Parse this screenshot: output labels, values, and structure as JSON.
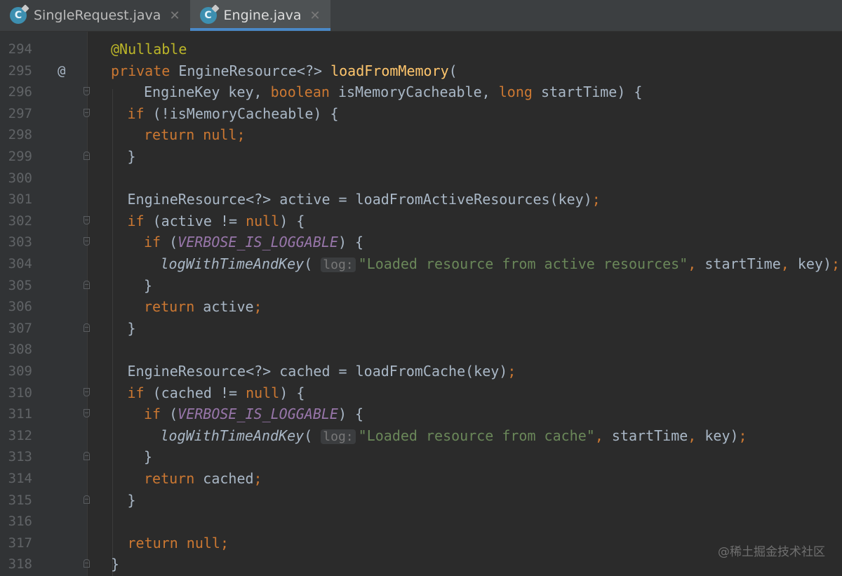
{
  "tabs": [
    {
      "label": "SingleRequest.java",
      "icon": "java-class-icon",
      "close": "✕",
      "active": false
    },
    {
      "label": "Engine.java",
      "icon": "java-class-icon",
      "close": "✕",
      "active": true
    }
  ],
  "colors": {
    "keyword": "#cc7832",
    "annotation": "#bbb529",
    "method": "#ffc66d",
    "string": "#6a8759",
    "constant": "#9876aa",
    "text": "#a9b7c6",
    "accent": "#4a88c7"
  },
  "editor": {
    "lines": [
      {
        "num": "294",
        "indent": 0,
        "gutter_mark": "",
        "fold": "",
        "tokens": [
          [
            "a",
            "@Nullable"
          ]
        ]
      },
      {
        "num": "295",
        "indent": 0,
        "gutter_mark": "@",
        "fold": "",
        "tokens": [
          [
            "k",
            "private "
          ],
          [
            "t",
            "EngineResource<?> "
          ],
          [
            "f",
            "loadFromMemory"
          ],
          [
            "t",
            "("
          ]
        ]
      },
      {
        "num": "296",
        "indent": 2,
        "gutter_mark": "",
        "fold": "open",
        "tokens": [
          [
            "t",
            "EngineKey key, "
          ],
          [
            "k",
            "boolean "
          ],
          [
            "t",
            "isMemoryCacheable, "
          ],
          [
            "k",
            "long "
          ],
          [
            "t",
            "startTime) {"
          ]
        ]
      },
      {
        "num": "297",
        "indent": 1,
        "gutter_mark": "",
        "fold": "open",
        "tokens": [
          [
            "k",
            "if "
          ],
          [
            "t",
            "(!isMemoryCacheable) {"
          ]
        ]
      },
      {
        "num": "298",
        "indent": 2,
        "gutter_mark": "",
        "fold": "",
        "tokens": [
          [
            "k",
            "return null;"
          ]
        ]
      },
      {
        "num": "299",
        "indent": 1,
        "gutter_mark": "",
        "fold": "close",
        "tokens": [
          [
            "t",
            "}"
          ]
        ]
      },
      {
        "num": "300",
        "indent": 0,
        "gutter_mark": "",
        "fold": "",
        "tokens": []
      },
      {
        "num": "301",
        "indent": 1,
        "gutter_mark": "",
        "fold": "",
        "tokens": [
          [
            "t",
            "EngineResource<?> active = loadFromActiveResources(key)"
          ],
          [
            "k",
            ";"
          ]
        ]
      },
      {
        "num": "302",
        "indent": 1,
        "gutter_mark": "",
        "fold": "open",
        "tokens": [
          [
            "k",
            "if "
          ],
          [
            "t",
            "(active != "
          ],
          [
            "k",
            "null"
          ],
          [
            "t",
            ") {"
          ]
        ]
      },
      {
        "num": "303",
        "indent": 2,
        "gutter_mark": "",
        "fold": "open",
        "tokens": [
          [
            "k",
            "if "
          ],
          [
            "t",
            "("
          ],
          [
            "c",
            "VERBOSE_IS_LOGGABLE"
          ],
          [
            "t",
            ") {"
          ]
        ]
      },
      {
        "num": "304",
        "indent": 3,
        "gutter_mark": "",
        "fold": "",
        "tokens": [
          [
            "i",
            "logWithTimeAndKey"
          ],
          [
            "t",
            "( "
          ],
          [
            "h",
            "log:"
          ],
          [
            "s",
            "\"Loaded resource from active resources\""
          ],
          [
            "k",
            ", "
          ],
          [
            "t",
            "startTime"
          ],
          [
            "k",
            ", "
          ],
          [
            "t",
            "key)"
          ],
          [
            "k",
            ";"
          ]
        ]
      },
      {
        "num": "305",
        "indent": 2,
        "gutter_mark": "",
        "fold": "close",
        "tokens": [
          [
            "t",
            "}"
          ]
        ]
      },
      {
        "num": "306",
        "indent": 2,
        "gutter_mark": "",
        "fold": "",
        "tokens": [
          [
            "k",
            "return "
          ],
          [
            "t",
            "active"
          ],
          [
            "k",
            ";"
          ]
        ]
      },
      {
        "num": "307",
        "indent": 1,
        "gutter_mark": "",
        "fold": "close",
        "tokens": [
          [
            "t",
            "}"
          ]
        ]
      },
      {
        "num": "308",
        "indent": 0,
        "gutter_mark": "",
        "fold": "",
        "tokens": []
      },
      {
        "num": "309",
        "indent": 1,
        "gutter_mark": "",
        "fold": "",
        "tokens": [
          [
            "t",
            "EngineResource<?> cached = loadFromCache(key)"
          ],
          [
            "k",
            ";"
          ]
        ]
      },
      {
        "num": "310",
        "indent": 1,
        "gutter_mark": "",
        "fold": "open",
        "tokens": [
          [
            "k",
            "if "
          ],
          [
            "t",
            "(cached != "
          ],
          [
            "k",
            "null"
          ],
          [
            "t",
            ") {"
          ]
        ]
      },
      {
        "num": "311",
        "indent": 2,
        "gutter_mark": "",
        "fold": "open",
        "tokens": [
          [
            "k",
            "if "
          ],
          [
            "t",
            "("
          ],
          [
            "c",
            "VERBOSE_IS_LOGGABLE"
          ],
          [
            "t",
            ") {"
          ]
        ]
      },
      {
        "num": "312",
        "indent": 3,
        "gutter_mark": "",
        "fold": "",
        "tokens": [
          [
            "i",
            "logWithTimeAndKey"
          ],
          [
            "t",
            "( "
          ],
          [
            "h",
            "log:"
          ],
          [
            "s",
            "\"Loaded resource from cache\""
          ],
          [
            "k",
            ", "
          ],
          [
            "t",
            "startTime"
          ],
          [
            "k",
            ", "
          ],
          [
            "t",
            "key)"
          ],
          [
            "k",
            ";"
          ]
        ]
      },
      {
        "num": "313",
        "indent": 2,
        "gutter_mark": "",
        "fold": "close",
        "tokens": [
          [
            "t",
            "}"
          ]
        ]
      },
      {
        "num": "314",
        "indent": 2,
        "gutter_mark": "",
        "fold": "",
        "tokens": [
          [
            "k",
            "return "
          ],
          [
            "t",
            "cached"
          ],
          [
            "k",
            ";"
          ]
        ]
      },
      {
        "num": "315",
        "indent": 1,
        "gutter_mark": "",
        "fold": "close",
        "tokens": [
          [
            "t",
            "}"
          ]
        ]
      },
      {
        "num": "316",
        "indent": 0,
        "gutter_mark": "",
        "fold": "",
        "tokens": []
      },
      {
        "num": "317",
        "indent": 1,
        "gutter_mark": "",
        "fold": "",
        "tokens": [
          [
            "k",
            "return null;"
          ]
        ]
      },
      {
        "num": "318",
        "indent": 0,
        "gutter_mark": "",
        "fold": "close",
        "tokens": [
          [
            "t",
            "}"
          ]
        ]
      }
    ]
  },
  "watermark": "@稀土掘金技术社区"
}
